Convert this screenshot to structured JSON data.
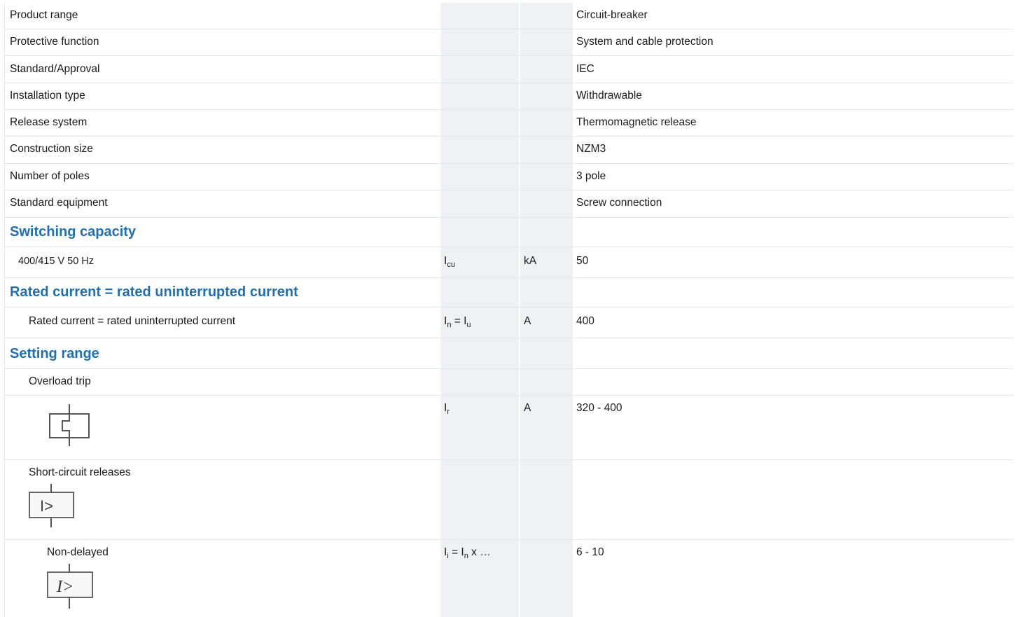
{
  "rows": {
    "product_range": {
      "label": "Product range",
      "value": "Circuit-breaker"
    },
    "protective_function": {
      "label": "Protective function",
      "value": "System and cable protection"
    },
    "standard_approval": {
      "label": "Standard/Approval",
      "value": "IEC"
    },
    "installation_type": {
      "label": "Installation type",
      "value": "Withdrawable"
    },
    "release_system": {
      "label": "Release system",
      "value": "Thermomagnetic release"
    },
    "construction_size": {
      "label": "Construction size",
      "value": "NZM3"
    },
    "number_of_poles": {
      "label": "Number of poles",
      "value": "3 pole"
    },
    "standard_equipment": {
      "label": "Standard equipment",
      "value": "Screw connection"
    }
  },
  "switching_capacity": {
    "heading": "Switching capacity",
    "row": {
      "label": "400/415 V 50 Hz",
      "symbol": "I",
      "symbol_sub": "cu",
      "unit": "kA",
      "value": "50"
    }
  },
  "rated_current": {
    "heading": "Rated current = rated uninterrupted current",
    "row": {
      "label": "Rated current = rated uninterrupted current",
      "sym_a": "I",
      "sym_a_sub": "n",
      "sym_mid": " = I",
      "sym_b_sub": "u",
      "unit": "A",
      "value": "400"
    }
  },
  "setting_range": {
    "heading": "Setting range",
    "overload": {
      "label": "Overload trip"
    },
    "overload_value": {
      "symbol": "I",
      "symbol_sub": "r",
      "unit": "A",
      "value": "320 - 400",
      "icon": "thermal-release-icon"
    },
    "short_circuit": {
      "label": "Short-circuit releases",
      "icon": "short-circuit-release-icon"
    },
    "non_delayed": {
      "label": "Non-delayed",
      "sym_a": "I",
      "sym_a_sub": "i",
      "sym_mid": " = I",
      "sym_b_sub": "n",
      "sym_tail": " x …",
      "value": "6 - 10",
      "icon": "instantaneous-release-icon"
    }
  }
}
